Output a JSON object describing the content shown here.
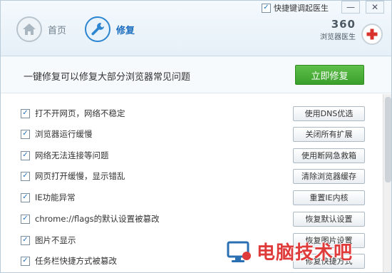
{
  "header": {
    "hotkey_checkbox_checked": true,
    "hotkey_label": "快捷键调起医生",
    "minimize_symbol": "—",
    "close_symbol": "✕",
    "nav": {
      "home_label": "首页",
      "repair_label": "修复",
      "active": "repair"
    },
    "brand": {
      "number": "360",
      "text": "浏览器医生"
    }
  },
  "banner": {
    "text": "一键修复可以修复大部分浏览器常见问题",
    "repair_now_label": "立即修复"
  },
  "items": [
    {
      "checked": true,
      "label": "打不开网页，网络不稳定",
      "button": "使用DNS优选"
    },
    {
      "checked": true,
      "label": "浏览器运行缓慢",
      "button": "关闭所有扩展"
    },
    {
      "checked": true,
      "label": "网络无法连接等问题",
      "button": "使用断网急救箱"
    },
    {
      "checked": true,
      "label": "网页打开缓慢，显示错乱",
      "button": "清除浏览器缓存"
    },
    {
      "checked": true,
      "label": "IE功能异常",
      "button": "重置IE内核"
    },
    {
      "checked": true,
      "label": "chrome://flags的默认设置被篡改",
      "button": "恢复默认设置"
    },
    {
      "checked": true,
      "label": "图片不显示",
      "button": "恢复图片设置"
    },
    {
      "checked": true,
      "label": "任务栏快捷方式被篡改",
      "button": "修复快捷方式"
    }
  ],
  "watermark": {
    "text": "电脑技术吧"
  },
  "colors": {
    "accent_blue": "#2b85d0",
    "repair_green": "#3a9f2b",
    "brand_red": "#e03b3b"
  }
}
